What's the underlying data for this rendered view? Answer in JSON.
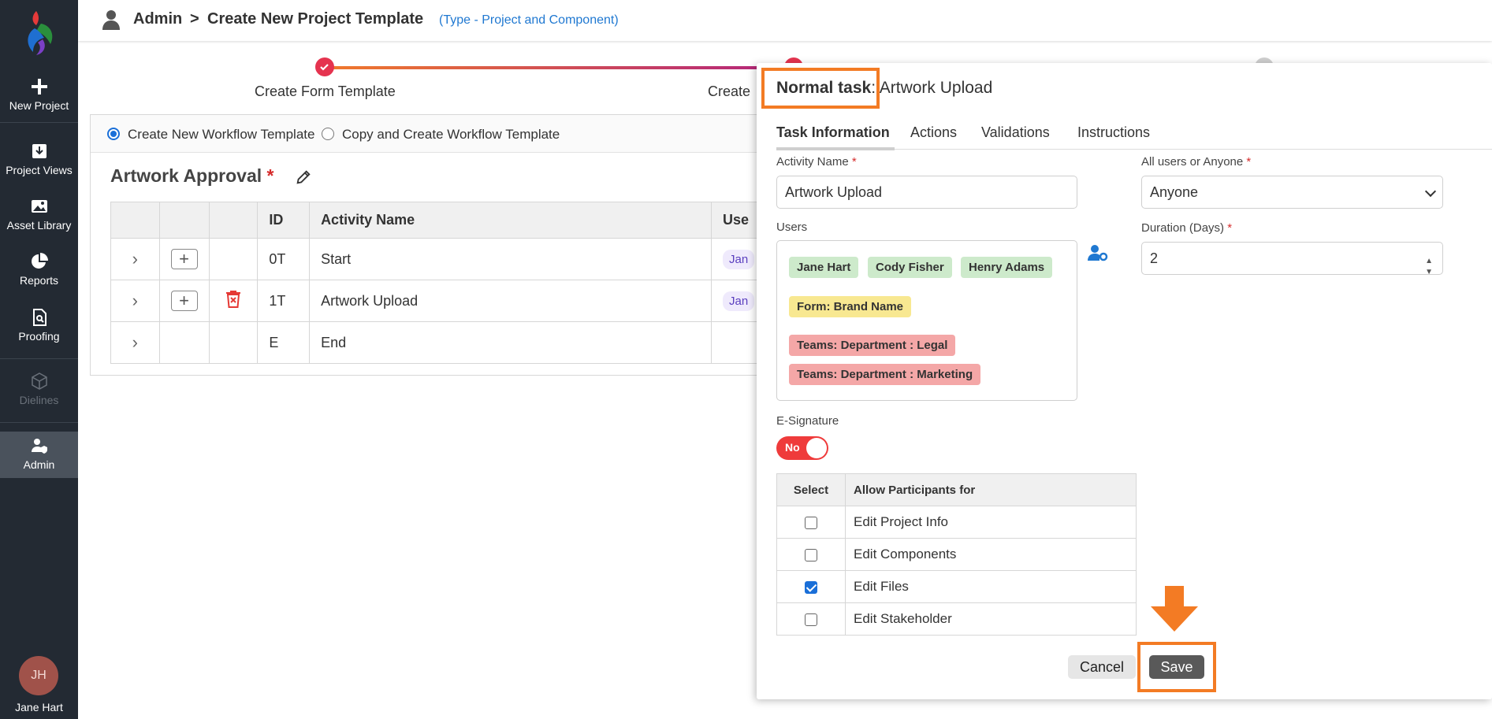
{
  "sidebar": {
    "items": [
      {
        "label": "New Project",
        "icon": "plus-icon"
      },
      {
        "label": "Project Views",
        "icon": "download-box-icon"
      },
      {
        "label": "Asset Library",
        "icon": "image-icon"
      },
      {
        "label": "Reports",
        "icon": "pie-chart-icon"
      },
      {
        "label": "Proofing",
        "icon": "document-search-icon"
      },
      {
        "label": "Dielines",
        "icon": "cube-icon"
      },
      {
        "label": "Admin",
        "icon": "user-shield-icon"
      }
    ],
    "user_initials": "JH",
    "user_name": "Jane Hart"
  },
  "header": {
    "crumb_root": "Admin",
    "separator": ">",
    "crumb_page": "Create New Project Template",
    "type_note": "(Type - Project and Component)"
  },
  "stepper": {
    "steps": [
      {
        "label": "Create Form Template",
        "state": "done"
      },
      {
        "label": "Create",
        "state": "active"
      },
      {
        "label": "",
        "state": "pending"
      }
    ]
  },
  "workflow": {
    "options": [
      "Create New Workflow Template",
      "Copy and Create Workflow Template"
    ],
    "selected_option": "Create New Workflow Template",
    "title": "Artwork Approval",
    "required_mark": "*",
    "columns": [
      "ID",
      "Activity Name",
      "Use"
    ],
    "rows": [
      {
        "id": "0T",
        "name": "Start",
        "user": "Jan"
      },
      {
        "id": "1T",
        "name": "Artwork Upload",
        "user": "Jan"
      },
      {
        "id": "E",
        "name": "End",
        "user": ""
      }
    ]
  },
  "panel": {
    "task_type": "Normal task",
    "task_name": ": Artwork Upload",
    "tabs": [
      "Task Information",
      "Actions",
      "Validations",
      "Instructions"
    ],
    "active_tab": "Task Information",
    "activity_name_label": "Activity Name",
    "activity_name_value": "Artwork Upload",
    "users_label": "Users",
    "user_tags": [
      "Jane Hart",
      "Cody Fisher",
      "Henry Adams"
    ],
    "form_tags": [
      "Form: Brand Name"
    ],
    "team_tags": [
      "Teams: Department : Legal",
      "Teams: Department : Marketing"
    ],
    "all_users_label": "All users or Anyone",
    "all_users_value": "Anyone",
    "duration_label": "Duration (Days)",
    "duration_value": "2",
    "required_mark": "*",
    "esignature_label": "E-Signature",
    "esignature_state": "No",
    "perm_columns": [
      "Select",
      "Allow Participants for"
    ],
    "permissions": [
      {
        "label": "Edit Project Info",
        "checked": false
      },
      {
        "label": "Edit Components",
        "checked": false
      },
      {
        "label": "Edit Files",
        "checked": true
      },
      {
        "label": "Edit Stakeholder",
        "checked": false
      }
    ],
    "cancel_label": "Cancel",
    "save_label": "Save"
  },
  "colors": {
    "sidebar_bg": "#232a33",
    "highlight": "#f37b24",
    "link_blue": "#1f78d1",
    "tag_green": "#cdeacb",
    "tag_yellow": "#f8e891",
    "tag_red": "#f4a7a7",
    "toggle_red": "#ef3b3b"
  }
}
